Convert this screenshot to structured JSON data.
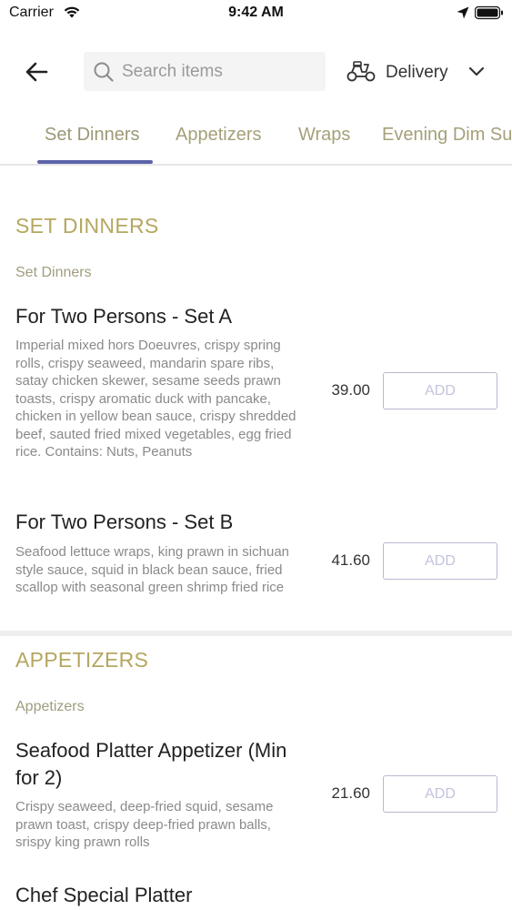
{
  "status_bar": {
    "carrier": "Carrier",
    "time": "9:42 AM"
  },
  "header": {
    "search_placeholder": "Search items",
    "delivery_label": "Delivery"
  },
  "tabs": [
    {
      "label": "Set Dinners",
      "active": true
    },
    {
      "label": "Appetizers",
      "active": false
    },
    {
      "label": "Wraps",
      "active": false
    },
    {
      "label": "Evening Dim Su",
      "active": false
    }
  ],
  "sections": [
    {
      "title": "SET DINNERS",
      "subtitle": "Set Dinners",
      "items": [
        {
          "name": "For Two Persons - Set A",
          "description": "Imperial mixed hors Doeuvres, crispy spring rolls, crispy seaweed, mandarin spare ribs, satay chicken skewer, sesame seeds prawn toasts, crispy aromatic duck with pancake, chicken in yellow bean sauce, crispy shredded beef, sauted fried mixed vegetables, egg fried rice.   Contains: Nuts, Peanuts",
          "price": "39.00",
          "add_label": "ADD"
        },
        {
          "name": "For Two Persons - Set B",
          "description": "Seafood lettuce wraps, king prawn in sichuan style sauce, squid in black bean sauce, fried scallop with seasonal green shrimp fried rice",
          "price": "41.60",
          "add_label": "ADD"
        }
      ]
    },
    {
      "title": "APPETIZERS",
      "subtitle": "Appetizers",
      "items": [
        {
          "name": "Seafood Platter Appetizer (Min for 2)",
          "description": "Crispy seaweed, deep-fried squid, sesame prawn toast, crispy deep-fried prawn balls, srispy king prawn rolls",
          "price": "21.60",
          "add_label": "ADD"
        },
        {
          "name": "Chef Special Platter"
        }
      ]
    }
  ],
  "icons": {
    "back": "arrow-left-icon",
    "search": "search-icon",
    "delivery": "scooter-icon",
    "dropdown": "chevron-down-icon",
    "wifi": "wifi-icon",
    "location": "location-arrow-icon",
    "battery": "battery-icon"
  },
  "colors": {
    "section_title": "#b5a760",
    "tab_text": "#a5a07a",
    "tab_indicator": "#5b63a8",
    "add_button_border": "#b7b9d2",
    "add_button_text": "#c2c4dc"
  }
}
